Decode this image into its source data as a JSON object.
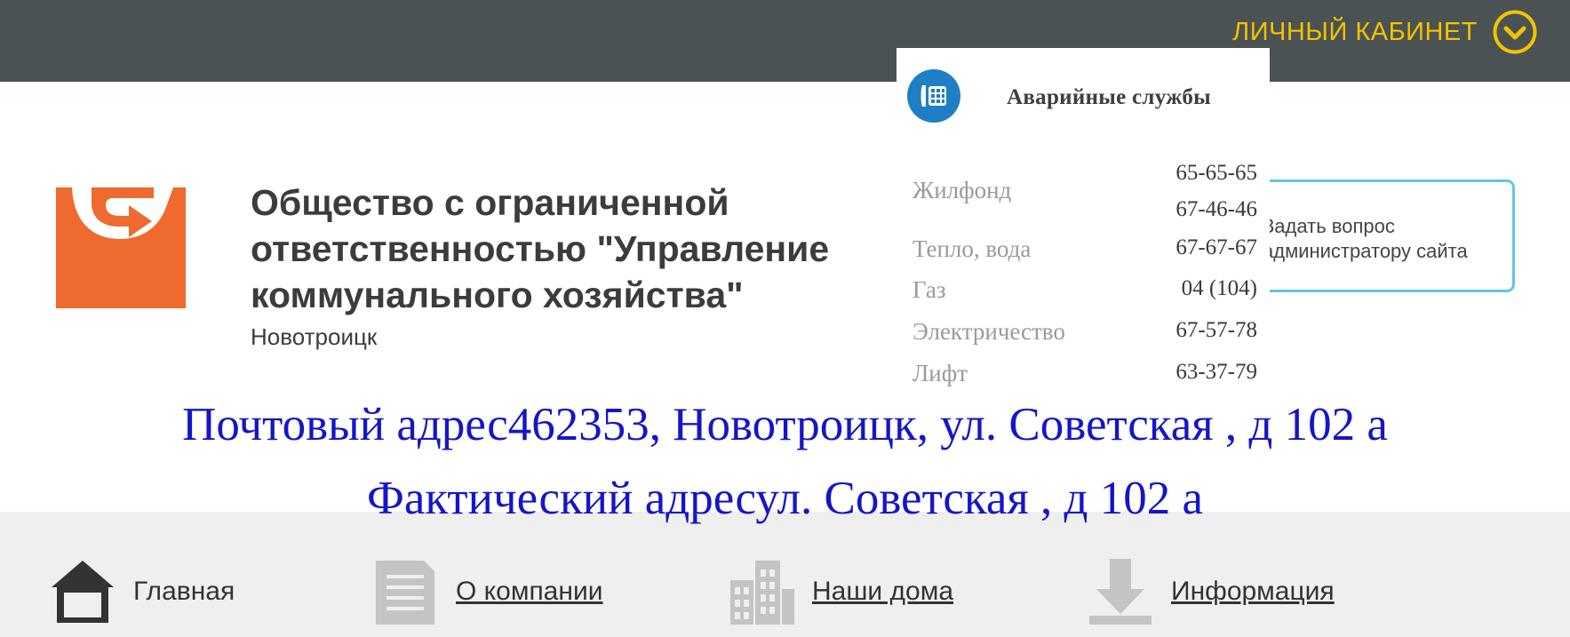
{
  "header": {
    "cabinet_label": "ЛИЧНЫЙ КАБИНЕТ"
  },
  "org": {
    "name": "Общество с ограниченной ответственностью \"Управление коммунального хозяйства\"",
    "city": "Новотроицк"
  },
  "ask_admin": {
    "text": "Задать вопрос администратору сайта"
  },
  "emergency": {
    "title": "Аварийные службы",
    "services": [
      {
        "label": "Жилфонд",
        "phone1": "65-65-65",
        "phone2": "67-46-46"
      },
      {
        "label": "Тепло, вода",
        "phone1": "67-67-67"
      },
      {
        "label": "Газ",
        "phone1": "04 (104)"
      },
      {
        "label": "Электричество",
        "phone1": "67-57-78"
      },
      {
        "label": "Лифт",
        "phone1": "63-37-79"
      }
    ]
  },
  "address": {
    "postal": "Почтовый адрес462353, Новотроицк, ул. Советская , д 102 а",
    "actual": "Фактический адресул. Советская , д 102 а"
  },
  "nav": {
    "items": [
      {
        "label": "Главная"
      },
      {
        "label": "О компании"
      },
      {
        "label": "Наши дома"
      },
      {
        "label": "Информация"
      }
    ]
  },
  "colors": {
    "topbar": "#4b5253",
    "accent": "#f0c300",
    "logo": "#ee6a2e",
    "address": "#1515c8",
    "ask_border": "#63c6e0",
    "emergency_icon": "#1f7fc4"
  },
  "icons": {
    "cabinet": "chevron-down-circle-icon",
    "emergency": "phone-keypad-icon",
    "nav": [
      "home-icon",
      "document-icon",
      "buildings-icon",
      "download-arrow-icon"
    ]
  }
}
